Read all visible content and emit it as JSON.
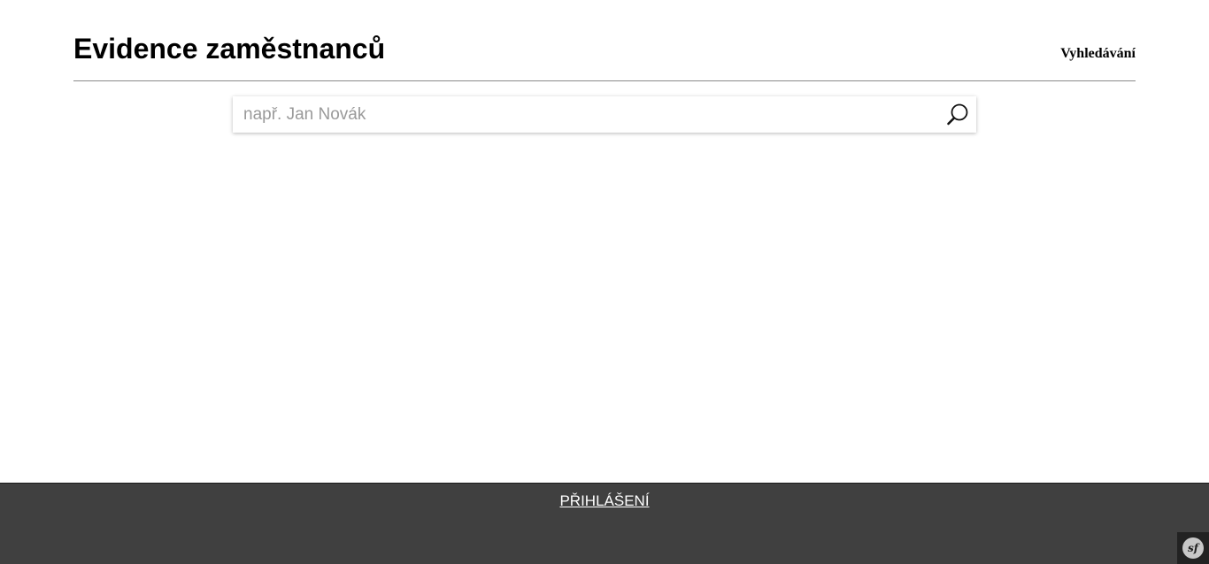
{
  "header": {
    "title": "Evidence zaměstnanců",
    "nav_search_label": "Vyhledávání"
  },
  "search": {
    "placeholder": "např. Jan Novák",
    "value": "",
    "button_icon": "search-icon"
  },
  "footer": {
    "login_label": "PŘIHLÁŠENÍ",
    "background": "#404040",
    "toolbar_icon": "symfony-logo-icon",
    "toolbar_logo_text": "sf"
  }
}
